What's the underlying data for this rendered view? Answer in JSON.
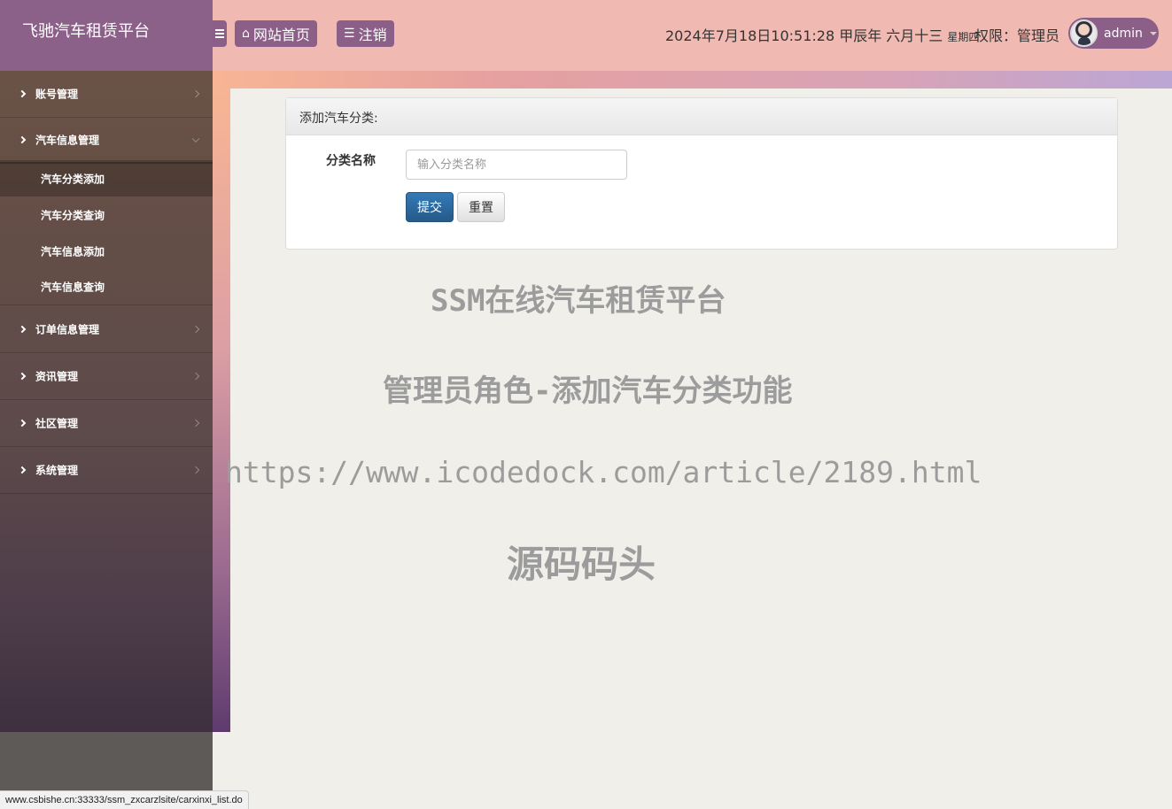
{
  "brand": {
    "title": "飞驰汽车租赁平台"
  },
  "topbar": {
    "home_label": "网站首页",
    "logout_label": "注销",
    "datetime": "2024年7月18日10:51:28 甲辰年 六月十三",
    "weekday": "星期四",
    "permission": "权限：管理员",
    "username": "admin"
  },
  "sidebar": {
    "items": [
      {
        "label": "账号管理"
      },
      {
        "label": "汽车信息管理"
      },
      {
        "label": "订单信息管理"
      },
      {
        "label": "资讯管理"
      },
      {
        "label": "社区管理"
      },
      {
        "label": "系统管理"
      }
    ],
    "subitems": [
      {
        "label": "汽车分类添加"
      },
      {
        "label": "汽车分类查询"
      },
      {
        "label": "汽车信息添加"
      },
      {
        "label": "汽车信息查询"
      }
    ]
  },
  "panel": {
    "title": "添加汽车分类:",
    "field_label": "分类名称",
    "field_value": "",
    "field_placeholder": "输入分类名称",
    "submit_label": "提交",
    "reset_label": "重置"
  },
  "watermark": {
    "line1": "SSM在线汽车租赁平台",
    "line2": "管理员角色-添加汽车分类功能",
    "line3": "https://www.icodedock.com/article/2189.html",
    "line4": "源码码头"
  },
  "statusbar": {
    "url": "www.csbishe.cn:33333/ssm_zxcarzlsite/carxinxi_list.do"
  }
}
